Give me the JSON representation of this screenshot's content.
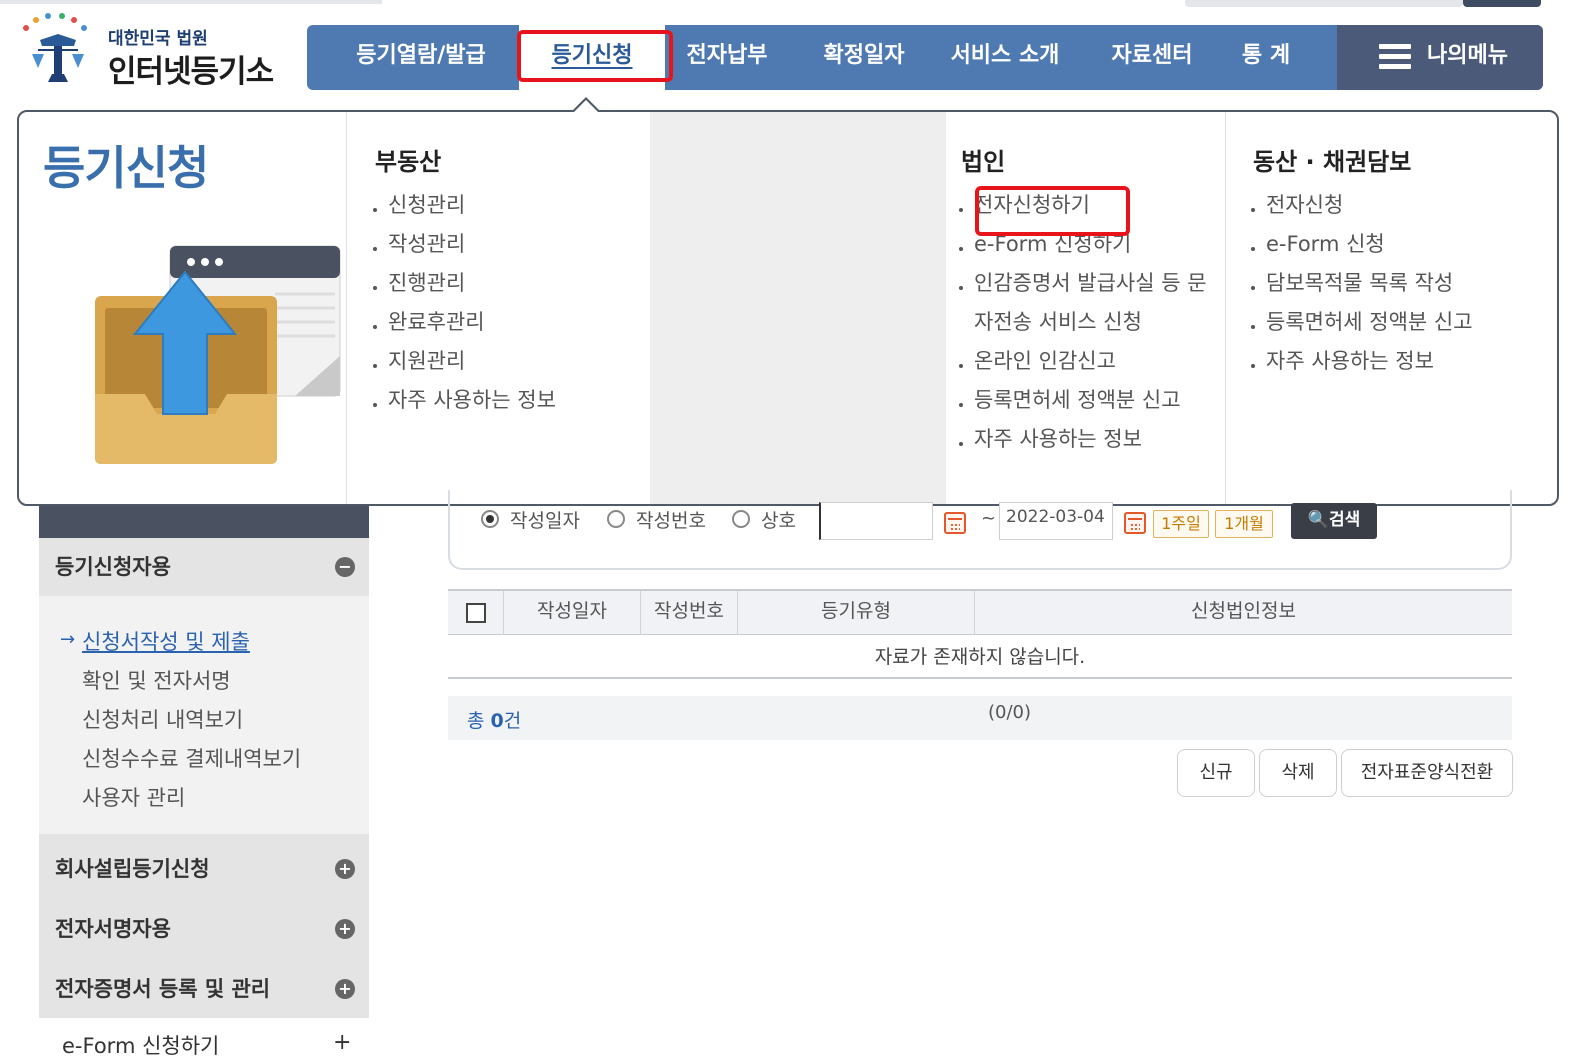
{
  "header": {
    "logo_small": "대한민국 법원",
    "logo_big": "인터넷등기소"
  },
  "nav": {
    "items": [
      "등기열람/발급",
      "등기신청",
      "전자납부",
      "확정일자",
      "서비스 소개",
      "자료센터",
      "통 계"
    ],
    "active": "등기신청",
    "my_menu": "나의메뉴"
  },
  "mega_menu": {
    "title": "등기신청",
    "columns": [
      {
        "heading": "부동산",
        "items": [
          "신청관리",
          "작성관리",
          "진행관리",
          "완료후관리",
          "지원관리",
          "자주 사용하는 정보"
        ]
      },
      {
        "heading": "법인",
        "items": [
          "전자신청하기",
          "e-Form 신청하기",
          "인감증명서 발급사실 등 문",
          "자전송 서비스 신청",
          "온라인 인감신고",
          "등록면허세 정액분 신고",
          "자주 사용하는 정보"
        ]
      },
      {
        "heading": "동산 · 채권담보",
        "items": [
          "전자신청",
          "e-Form 신청",
          "담보목적물 목록 작성",
          "등록면허세 정액분 신고",
          "자주 사용하는 정보"
        ]
      }
    ]
  },
  "sidebar": {
    "section_open": "등기신청자용",
    "links": [
      "신청서작성 및 제출",
      "확인 및 전자서명",
      "신청처리 내역보기",
      "신청수수료 결제내역보기",
      "사용자 관리"
    ],
    "active_link": "신청서작성 및 제출",
    "sections_closed": [
      "회사설립등기신청",
      "전자서명자용",
      "전자증명서 등록 및 관리"
    ],
    "bottom_item": "e-Form 신청하기"
  },
  "search": {
    "radio_options": [
      "작성일자",
      "작성번호",
      "상호"
    ],
    "selected": "작성일자",
    "date_from": "",
    "date_to": "2022-03-04",
    "period_buttons": [
      "1주일",
      "1개월"
    ],
    "search_label": "검색"
  },
  "table": {
    "columns": [
      "작성일자",
      "작성번호",
      "등기유형",
      "신청법인정보"
    ],
    "empty_message": "자료가 존재하지 않습니다.",
    "total_prefix": "총",
    "total_count": "0",
    "total_suffix": "건",
    "pager": "(0/0)"
  },
  "actions": [
    "신규",
    "삭제",
    "전자표준양식전환"
  ],
  "colors": {
    "nav_bg": "#4f7ab1",
    "my_menu_bg": "#4a5a78",
    "highlight": "#e8141c",
    "accent_blue": "#3a6fae"
  }
}
